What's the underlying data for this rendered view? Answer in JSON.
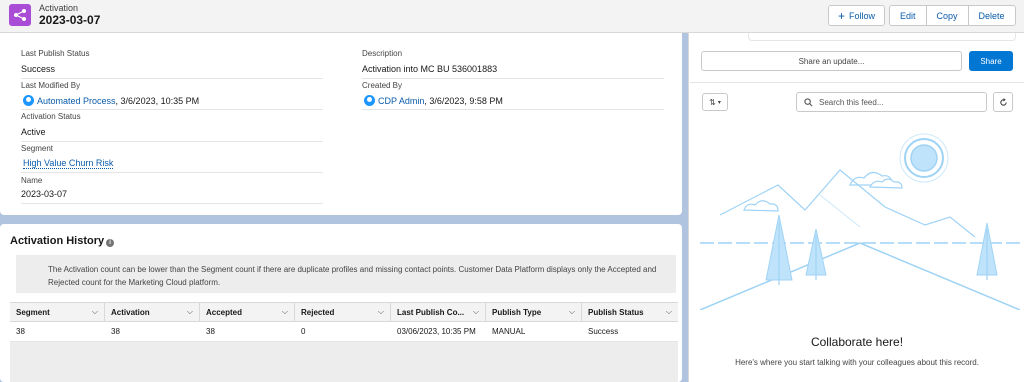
{
  "header": {
    "object_label": "Activation",
    "record_title": "2023-03-07",
    "follow_label": "Follow",
    "edit_label": "Edit",
    "copy_label": "Copy",
    "delete_label": "Delete"
  },
  "details": {
    "last_publish_status": {
      "label": "Last Publish Status",
      "value": "Success"
    },
    "last_modified_by": {
      "label": "Last Modified By",
      "user": "Automated Process",
      "date": ", 3/6/2023, 10:35 PM"
    },
    "activation_status": {
      "label": "Activation Status",
      "value": "Active"
    },
    "segment": {
      "label": "Segment",
      "value": "High Value Churn Risk"
    },
    "name": {
      "label": "Name",
      "value": "2023-03-07"
    },
    "description": {
      "label": "Description",
      "value": "Activation into MC BU 536001883"
    },
    "created_by": {
      "label": "Created By",
      "user": "CDP Admin",
      "date": ", 3/6/2023, 9:58 PM"
    }
  },
  "history": {
    "title": "Activation History",
    "info_icon": "i",
    "notice": "The Activation count can be lower than the Segment count if there are duplicate profiles and missing contact points. Customer Data Platform displays only the Accepted and Rejected count for the Marketing Cloud platform.",
    "columns": [
      "Segment",
      "Activation",
      "Accepted",
      "Rejected",
      "Last Publish Co...",
      "Publish Type",
      "Publish Status"
    ],
    "rows": [
      [
        "38",
        "38",
        "38",
        "0",
        "03/06/2023, 10:35 PM",
        "MANUAL",
        "Success"
      ]
    ]
  },
  "feed": {
    "share_placeholder": "Share an update...",
    "share_label": "Share",
    "sort_icon": "⇅",
    "search_placeholder": "Search this feed...",
    "collaborate_title": "Collaborate here!",
    "collaborate_text": "Here's where you start talking with your colleagues about this record."
  },
  "colors": {
    "brand": "#0176d3",
    "object_icon": "#a94dd6",
    "link": "#0b5cab"
  }
}
